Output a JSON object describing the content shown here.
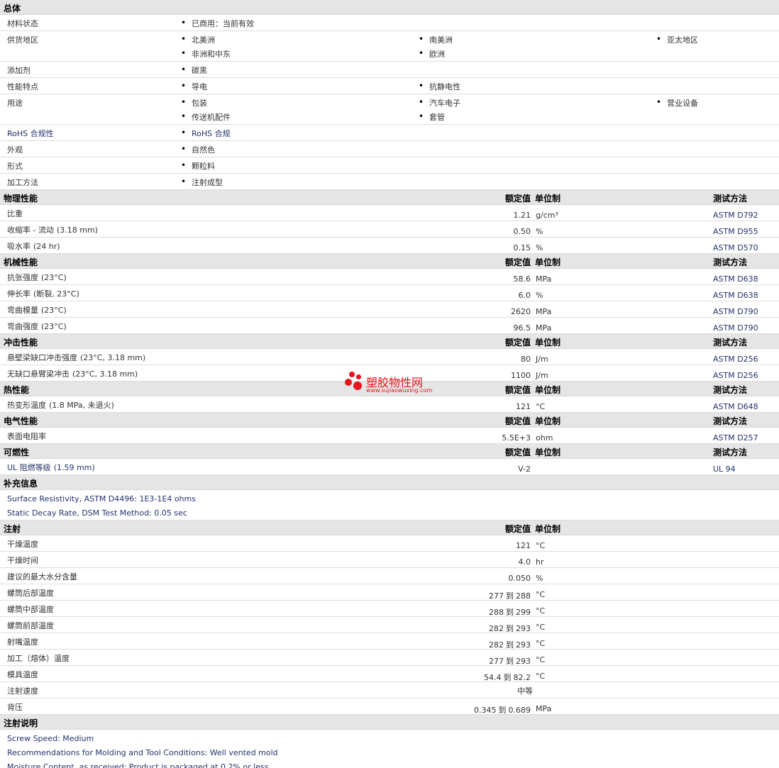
{
  "general": {
    "title": "总体",
    "rows": [
      {
        "label": "材料状态",
        "items": [
          "已商用：当前有效"
        ]
      },
      {
        "label": "供货地区",
        "items": [
          "北美洲",
          "南美洲",
          "亚太地区",
          "非洲和中东",
          "欧洲"
        ]
      },
      {
        "label": "添加剂",
        "items": [
          "碳黑"
        ]
      },
      {
        "label": "性能特点",
        "items": [
          "导电",
          "抗静电性"
        ]
      },
      {
        "label": "用途",
        "items": [
          "包装",
          "汽车电子",
          "营业设备",
          "传送机配件",
          "套管"
        ]
      },
      {
        "label": "RoHS 合规性",
        "items": [
          "RoHS 合规"
        ]
      },
      {
        "label": "外观",
        "items": [
          "自然色"
        ]
      },
      {
        "label": "形式",
        "items": [
          "颗粒料"
        ]
      },
      {
        "label": "加工方法",
        "items": [
          "注射成型"
        ]
      }
    ]
  },
  "headers": {
    "value": "额定值",
    "unit": "单位制",
    "method": "测试方法"
  },
  "physical": {
    "title": "物理性能",
    "rows": [
      {
        "label": "比重",
        "cond": "",
        "value": "1.21",
        "unit": "g/cm³",
        "method": "ASTM D792"
      },
      {
        "label": "收缩率 - 流动",
        "cond": "(3.18 mm)",
        "value": "0.50",
        "unit": "%",
        "method": "ASTM D955"
      },
      {
        "label": "吸水率",
        "cond": "(24 hr)",
        "value": "0.15",
        "unit": "%",
        "method": "ASTM D570"
      }
    ]
  },
  "mechanical": {
    "title": "机械性能",
    "rows": [
      {
        "label": "抗张强度",
        "cond": "(23°C)",
        "value": "58.6",
        "unit": "MPa",
        "method": "ASTM D638"
      },
      {
        "label": "伸长率",
        "cond": "(断裂, 23°C)",
        "value": "6.0",
        "unit": "%",
        "method": "ASTM D638"
      },
      {
        "label": "弯曲模量",
        "cond": "(23°C)",
        "value": "2620",
        "unit": "MPa",
        "method": "ASTM D790"
      },
      {
        "label": "弯曲强度",
        "cond": "(23°C)",
        "value": "96.5",
        "unit": "MPa",
        "method": "ASTM D790"
      }
    ]
  },
  "impact": {
    "title": "冲击性能",
    "rows": [
      {
        "label": "悬壁梁缺口冲击强度",
        "cond": "(23°C, 3.18 mm)",
        "value": "80",
        "unit": "J/m",
        "method": "ASTM D256"
      },
      {
        "label": "无缺口悬臂梁冲击",
        "cond": "(23°C, 3.18 mm)",
        "value": "1100",
        "unit": "J/m",
        "method": "ASTM D256"
      }
    ]
  },
  "thermal": {
    "title": "热性能",
    "rows": [
      {
        "label": "热变形温度",
        "cond": "(1.8 MPa, 未退火)",
        "value": "121",
        "unit": "°C",
        "method": "ASTM D648"
      }
    ]
  },
  "electrical": {
    "title": "电气性能",
    "rows": [
      {
        "label": "表面电阻率",
        "cond": "",
        "value": "5.5E+3",
        "unit": "ohm",
        "method": "ASTM D257"
      }
    ]
  },
  "flammability": {
    "title": "可燃性",
    "rows": [
      {
        "label": "UL 阻燃等级",
        "cond": "(1.59 mm)",
        "value": "V-2",
        "unit": "",
        "method": "UL 94"
      }
    ]
  },
  "supplement": {
    "title": "补充信息",
    "notes": [
      "Surface Resistivity, ASTM D4496: 1E3-1E4 ohms",
      "Static Decay Rate, DSM Test Method: 0.05 sec"
    ]
  },
  "injection": {
    "title": "注射",
    "rows": [
      {
        "label": "干燥温度",
        "value": "121",
        "unit": "°C"
      },
      {
        "label": "干燥时间",
        "value": "4.0",
        "unit": "hr"
      },
      {
        "label": "建议的最大水分含量",
        "value": "0.050",
        "unit": "%"
      },
      {
        "label": "螺筒后部温度",
        "from": "277",
        "to": "288",
        "unit": "°C"
      },
      {
        "label": "螺筒中部温度",
        "from": "288",
        "to": "299",
        "unit": "°C"
      },
      {
        "label": "螺筒前部温度",
        "from": "282",
        "to": "293",
        "unit": "°C"
      },
      {
        "label": "射嘴温度",
        "from": "282",
        "to": "293",
        "unit": "°C"
      },
      {
        "label": "加工（熔体）温度",
        "from": "277",
        "to": "293",
        "unit": "°C"
      },
      {
        "label": "模具温度",
        "from": "54.4",
        "to": "82.2",
        "unit": "°C"
      },
      {
        "label": "注射速度",
        "center": "中等"
      },
      {
        "label": "背压",
        "from": "0.345",
        "to": "0.689",
        "unit": "MPa"
      }
    ],
    "to_word": "到"
  },
  "injection_notes": {
    "title": "注射说明",
    "notes": [
      "Screw Speed: Medium",
      "Recommendations for Molding and Tool Conditions: Well vented mold",
      "Moisture Content, as received: Product is packaged at 0.2% or less."
    ]
  },
  "watermark": {
    "brand": "塑胶物性网",
    "url": "www.sujiaowuxing.com",
    "color": "#e8141b"
  }
}
